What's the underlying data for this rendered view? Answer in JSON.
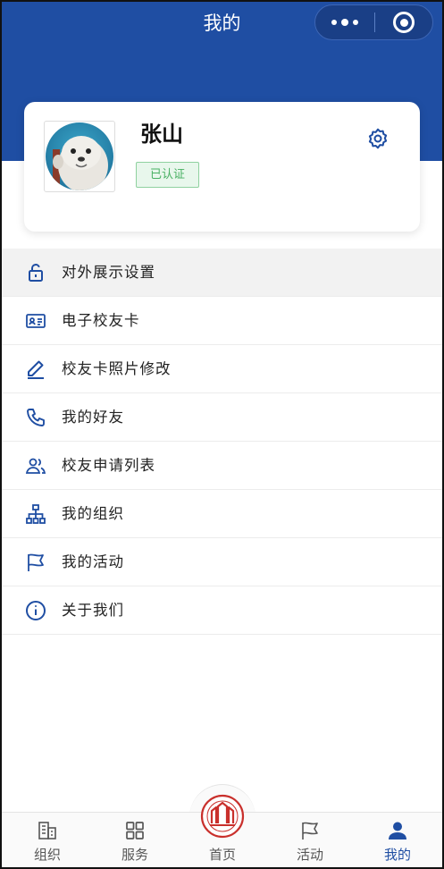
{
  "header": {
    "title": "我的"
  },
  "profile": {
    "name": "张山",
    "badge": "已认证"
  },
  "menu": [
    {
      "label": "对外展示设置",
      "icon": "lock-icon"
    },
    {
      "label": "电子校友卡",
      "icon": "id-card-icon"
    },
    {
      "label": "校友卡照片修改",
      "icon": "pencil-icon"
    },
    {
      "label": "我的好友",
      "icon": "phone-icon"
    },
    {
      "label": "校友申请列表",
      "icon": "users-icon"
    },
    {
      "label": "我的组织",
      "icon": "org-chart-icon"
    },
    {
      "label": "我的活动",
      "icon": "flag-icon"
    },
    {
      "label": "关于我们",
      "icon": "info-icon"
    }
  ],
  "tabs": [
    {
      "label": "组织",
      "icon": "building-icon"
    },
    {
      "label": "服务",
      "icon": "grid-icon"
    },
    {
      "label": "首页",
      "icon": "school-logo-icon"
    },
    {
      "label": "活动",
      "icon": "flag-icon"
    },
    {
      "label": "我的",
      "icon": "person-icon"
    }
  ],
  "colors": {
    "primary": "#1f4ea3",
    "verified_green": "#49b063"
  }
}
